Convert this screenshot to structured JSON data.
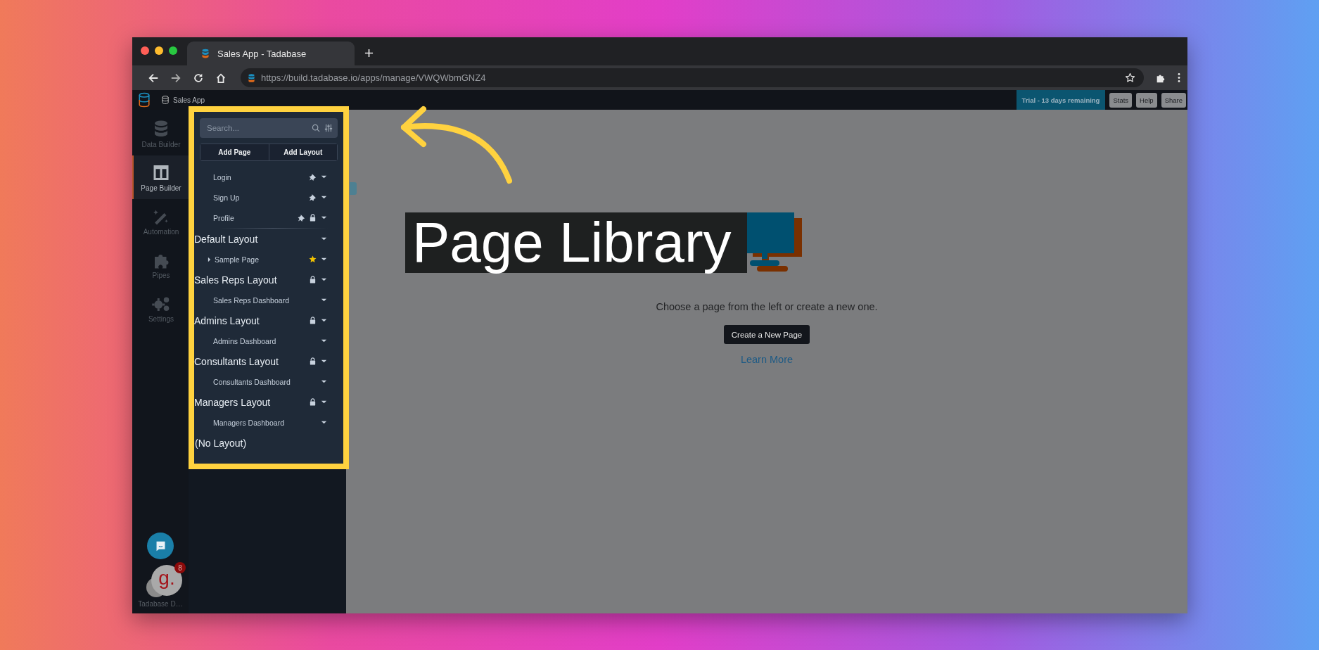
{
  "browser": {
    "tab_title": "Sales App - Tadabase",
    "url": "https://build.tadabase.io/apps/manage/VWQWbmGNZ4"
  },
  "app_bar": {
    "app_name": "Sales App",
    "trial": "Trial - 13 days remaining",
    "buttons": [
      "Stats",
      "Help",
      "Share"
    ]
  },
  "nav": [
    {
      "label": "Data Builder",
      "kind": "database",
      "selected": false
    },
    {
      "label": "Page Builder",
      "kind": "columns",
      "selected": true
    },
    {
      "label": "Automation",
      "kind": "wand",
      "selected": false
    },
    {
      "label": "Pipes",
      "kind": "puzzle",
      "selected": false
    },
    {
      "label": "Settings",
      "kind": "gears",
      "selected": false
    }
  ],
  "rail_bottom": {
    "avatar_text": "g.",
    "notification_count": "8",
    "user_label": "Tadabase D…"
  },
  "page_list": {
    "search_placeholder": "Search...",
    "buttons": [
      "Add Page",
      "Add Layout"
    ],
    "pages": [
      {
        "label": "Login",
        "pinned": true,
        "locked": false
      },
      {
        "label": "Sign Up",
        "pinned": true,
        "locked": false
      },
      {
        "label": "Profile",
        "pinned": true,
        "locked": true
      }
    ],
    "layouts": [
      {
        "name": "Default Layout",
        "locked": false,
        "pages": [
          {
            "label": "Sample Page",
            "starred": true,
            "has_children": true
          }
        ]
      },
      {
        "name": "Sales Reps Layout",
        "locked": true,
        "pages": [
          {
            "label": "Sales Reps Dashboard",
            "starred": false,
            "has_children": false
          }
        ]
      },
      {
        "name": "Admins Layout",
        "locked": true,
        "pages": [
          {
            "label": "Admins Dashboard",
            "starred": false,
            "has_children": false
          }
        ]
      },
      {
        "name": "Consultants Layout",
        "locked": true,
        "pages": [
          {
            "label": "Consultants Dashboard",
            "starred": false,
            "has_children": false
          }
        ]
      },
      {
        "name": "Managers Layout",
        "locked": true,
        "pages": [
          {
            "label": "Managers Dashboard",
            "starred": false,
            "has_children": false
          }
        ]
      }
    ],
    "no_layout": "(No Layout)"
  },
  "main": {
    "callout_title": "Page Library",
    "message": "Choose a page from the left or create a new one.",
    "button": "Create a New Page",
    "link": "Learn More"
  }
}
